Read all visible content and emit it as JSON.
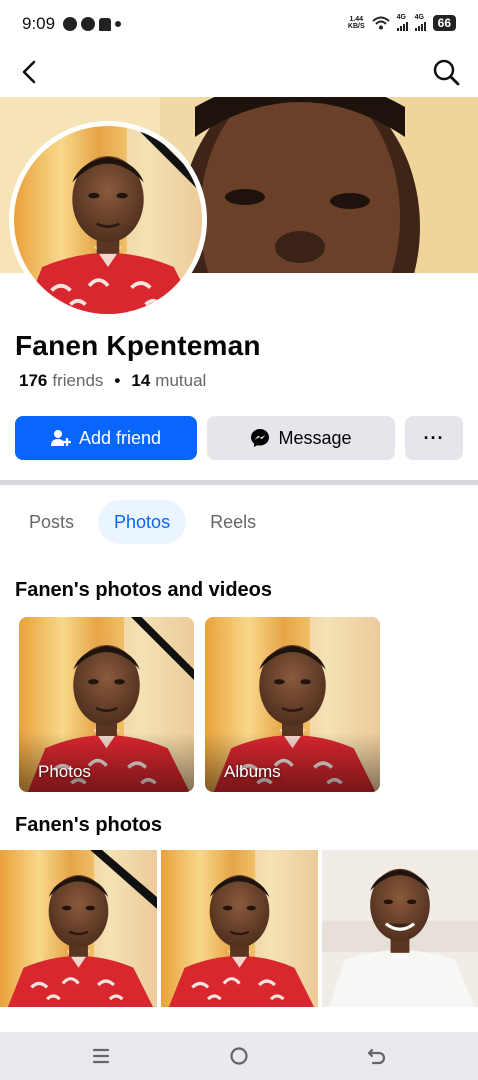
{
  "status_bar": {
    "time": "9:09",
    "speed_top": "1.44",
    "speed_bottom": "KB/S",
    "signal1_label": "4G",
    "signal2_label": "4G",
    "battery": "66"
  },
  "top_nav": {
    "back_icon": "back-chevron-icon",
    "search_icon": "search-icon"
  },
  "profile": {
    "name": "Fanen Kpenteman",
    "friends_count": "176",
    "friends_label": "friends",
    "mutual_count": "14",
    "mutual_label": "mutual"
  },
  "actions": {
    "add_friend": "Add friend",
    "message": "Message",
    "more": "···"
  },
  "tabs": [
    {
      "label": "Posts",
      "active": false
    },
    {
      "label": "Photos",
      "active": true
    },
    {
      "label": "Reels",
      "active": false
    }
  ],
  "sections": {
    "photos_and_videos_title": "Fanen's photos and videos",
    "photos_title": "Fanen's photos"
  },
  "albums": [
    {
      "label": "Photos"
    },
    {
      "label": "Albums"
    }
  ],
  "colors": {
    "accent": "#0866ff",
    "active_tab_bg": "#ebf5ff",
    "button_gray": "#e4e6eb",
    "secondary_text": "#65676b"
  }
}
